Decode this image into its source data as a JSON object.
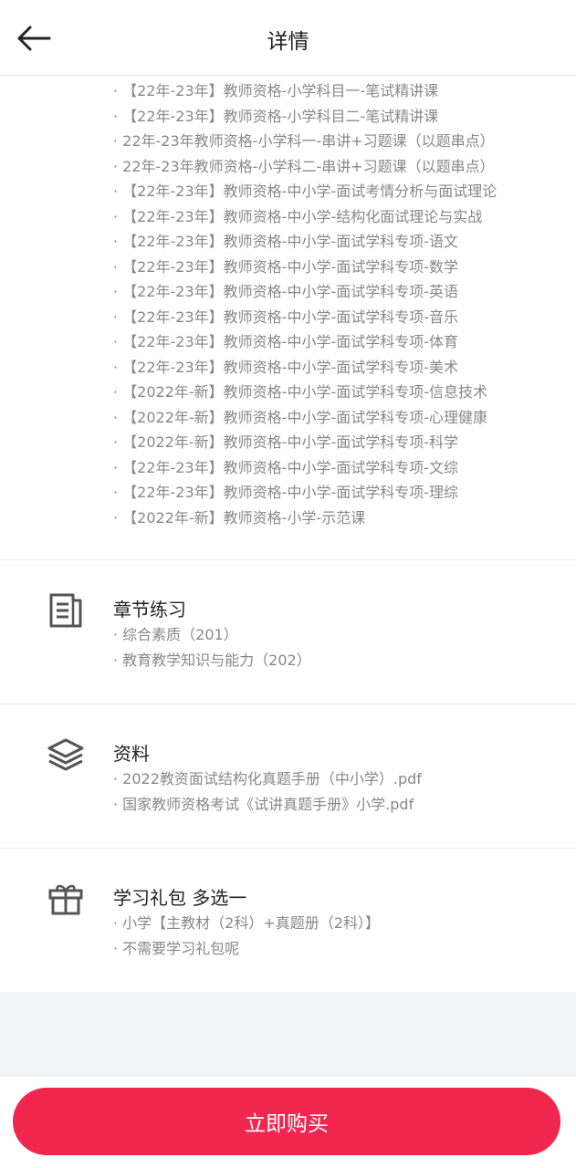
{
  "header": {
    "title": "详情"
  },
  "courses": [
    "· 【22年-23年】教师资格-小学科目一-笔试精讲课",
    "· 【22年-23年】教师资格-小学科目二-笔试精讲课",
    "· 22年-23年教师资格-小学科一-串讲+习题课（以题串点）",
    "· 22年-23年教师资格-小学科二-串讲+习题课（以题串点）",
    "· 【22年-23年】教师资格-中小学-面试考情分析与面试理论",
    "· 【22年-23年】教师资格-中小学-结构化面试理论与实战",
    "· 【22年-23年】教师资格-中小学-面试学科专项-语文",
    "· 【22年-23年】教师资格-中小学-面试学科专项-数学",
    "· 【22年-23年】教师资格-中小学-面试学科专项-英语",
    "· 【22年-23年】教师资格-中小学-面试学科专项-音乐",
    "· 【22年-23年】教师资格-中小学-面试学科专项-体育",
    "· 【22年-23年】教师资格-中小学-面试学科专项-美术",
    "· 【2022年-新】教师资格-中小学-面试学科专项-信息技术",
    "· 【2022年-新】教师资格-中小学-面试学科专项-心理健康",
    "· 【2022年-新】教师资格-中小学-面试学科专项-科学",
    "· 【22年-23年】教师资格-中小学-面试学科专项-文综",
    "· 【22年-23年】教师资格-中小学-面试学科专项-理综",
    "· 【2022年-新】教师资格-小学-示范课"
  ],
  "practice": {
    "title": "章节练习",
    "icon": "document-list-icon",
    "items": [
      "· 综合素质（201）",
      "· 教育教学知识与能力（202）"
    ]
  },
  "materials": {
    "title": "资料",
    "icon": "layers-icon",
    "items": [
      "· 2022教资面试结构化真题手册（中小学）.pdf",
      "· 国家教师资格考试《试讲真题手册》小学.pdf"
    ]
  },
  "gift": {
    "title": "学习礼包 多选一",
    "icon": "gift-icon",
    "items": [
      "· 小学【主教材（2科）+真题册（2科）】",
      "· 不需要学习礼包呢"
    ]
  },
  "footer": {
    "buy_label": "立即购买",
    "accent_color": "#f0264f"
  }
}
